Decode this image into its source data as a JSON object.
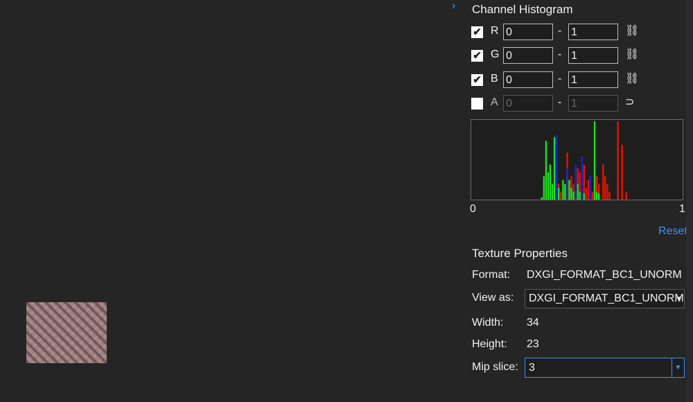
{
  "panel": {
    "title": "Channel Histogram",
    "channels": [
      {
        "name": "R",
        "checked": true,
        "min": "0",
        "max": "1",
        "enabled": true,
        "color": "#e51400"
      },
      {
        "name": "G",
        "checked": true,
        "min": "0",
        "max": "1",
        "enabled": true,
        "color": "#1ee01e"
      },
      {
        "name": "B",
        "checked": true,
        "min": "0",
        "max": "1",
        "enabled": true,
        "color": "#1f1fd0"
      },
      {
        "name": "A",
        "checked": false,
        "min": "0",
        "max": "1",
        "enabled": false,
        "color": "#ffffff"
      }
    ],
    "check_glyph": "✔",
    "dash": "-",
    "link_glyph": "⛓",
    "unlink_glyph": "⊃",
    "axis_min_label": "0",
    "axis_max_label": "1",
    "reset_label": "Reset"
  },
  "histogram": {
    "bins": 100,
    "series": [
      {
        "name": "R",
        "color": "#e51400",
        "bars": [
          [
            38,
            0.05
          ],
          [
            41,
            0.2
          ],
          [
            42,
            0.1
          ],
          [
            44,
            0.15
          ],
          [
            45,
            0.6
          ],
          [
            46,
            0.25
          ],
          [
            47,
            0.3
          ],
          [
            48,
            0.2
          ],
          [
            49,
            0.1
          ],
          [
            50,
            0.4
          ],
          [
            51,
            0.35
          ],
          [
            52,
            0.2
          ],
          [
            53,
            0.45
          ],
          [
            54,
            0.15
          ],
          [
            55,
            0.25
          ],
          [
            56,
            0.12
          ],
          [
            57,
            0.1
          ],
          [
            58,
            0.5
          ],
          [
            59,
            0.3
          ],
          [
            60,
            0.2
          ],
          [
            62,
            0.45
          ],
          [
            63,
            0.3
          ],
          [
            64,
            0.2
          ],
          [
            65,
            0.1
          ],
          [
            69,
            1.0
          ],
          [
            71,
            0.7
          ],
          [
            73,
            0.1
          ]
        ]
      },
      {
        "name": "G",
        "color": "#1ee01e",
        "bars": [
          [
            33,
            0.03
          ],
          [
            34,
            0.3
          ],
          [
            35,
            0.75
          ],
          [
            36,
            0.35
          ],
          [
            37,
            0.45
          ],
          [
            38,
            0.2
          ],
          [
            39,
            0.8
          ],
          [
            40,
            0.3
          ],
          [
            41,
            0.15
          ],
          [
            43,
            0.25
          ],
          [
            44,
            0.2
          ],
          [
            45,
            0.3
          ],
          [
            46,
            0.25
          ],
          [
            47,
            0.15
          ],
          [
            48,
            0.1
          ],
          [
            49,
            0.12
          ],
          [
            50,
            0.2
          ],
          [
            51,
            0.1
          ],
          [
            52,
            0.15
          ],
          [
            53,
            0.08
          ],
          [
            58,
            1.0
          ],
          [
            59,
            0.1
          ],
          [
            60,
            0.08
          ]
        ]
      },
      {
        "name": "B",
        "color": "#1f1fd0",
        "bars": [
          [
            40,
            0.82
          ],
          [
            45,
            0.4
          ],
          [
            49,
            0.45
          ],
          [
            52,
            0.55
          ],
          [
            56,
            0.3
          ]
        ]
      }
    ]
  },
  "texture": {
    "section_title": "Texture Properties",
    "format_label": "Format:",
    "format_value": "DXGI_FORMAT_BC1_UNORM",
    "view_as_label": "View as:",
    "view_as_value": "DXGI_FORMAT_BC1_UNORM",
    "width_label": "Width:",
    "width_value": "34",
    "height_label": "Height:",
    "height_value": "23",
    "mip_label": "Mip slice:",
    "mip_value": "3"
  },
  "icons": {
    "collapse": "›",
    "dropdown": "▾",
    "mip_dropdown": "▼"
  }
}
